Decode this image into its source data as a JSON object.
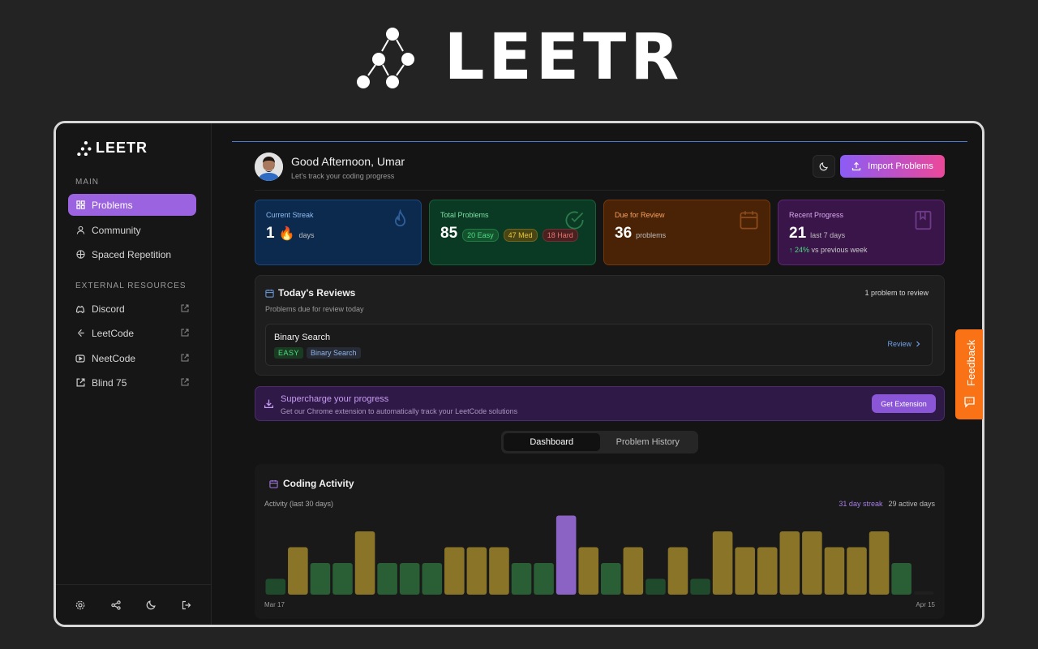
{
  "hero": {
    "title": "LEETR"
  },
  "sidebar": {
    "brand": "LEETR",
    "main_heading": "MAIN",
    "main_items": [
      {
        "label": "Problems",
        "icon": "grid-icon",
        "active": true
      },
      {
        "label": "Community",
        "icon": "user-icon",
        "active": false
      },
      {
        "label": "Spaced Repetition",
        "icon": "brain-icon",
        "active": false
      }
    ],
    "external_heading": "EXTERNAL RESOURCES",
    "external_items": [
      {
        "label": "Discord",
        "icon": "discord-icon"
      },
      {
        "label": "LeetCode",
        "icon": "leetcode-icon"
      },
      {
        "label": "NeetCode",
        "icon": "youtube-icon"
      },
      {
        "label": "Blind 75",
        "icon": "external-link-icon"
      }
    ],
    "bottom_icons": [
      "settings-icon",
      "share-icon",
      "moon-icon",
      "logout-icon"
    ]
  },
  "header": {
    "greeting": "Good Afternoon, Umar",
    "subtitle": "Let's track your coding progress",
    "import_label": "Import Problems"
  },
  "stats": {
    "streak": {
      "label": "Current Streak",
      "value": "1",
      "emoji": "🔥",
      "unit": "days"
    },
    "total": {
      "label": "Total Problems",
      "value": "85",
      "easy": "20 Easy",
      "med": "47 Med",
      "hard": "18 Hard"
    },
    "due": {
      "label": "Due for Review",
      "value": "36",
      "unit": "problems"
    },
    "recent": {
      "label": "Recent Progress",
      "value": "21",
      "unit": "last 7 days",
      "trend_pct": "↑ 24%",
      "trend_text": "vs previous week"
    }
  },
  "reviews": {
    "title": "Today's Reviews",
    "count": "1 problem to review",
    "subtitle": "Problems due for review today",
    "item": {
      "name": "Binary Search",
      "difficulty": "EASY",
      "topic": "Binary Search",
      "action": "Review"
    }
  },
  "promo": {
    "title": "Supercharge your progress",
    "subtitle": "Get our Chrome extension to automatically track your LeetCode solutions",
    "button": "Get Extension"
  },
  "tabs": [
    "Dashboard",
    "Problem History"
  ],
  "activity": {
    "title": "Coding Activity",
    "subtitle": "Activity (last 30 days)",
    "streak": "31 day streak",
    "active_days": "29 active days",
    "x_start": "Mar 17",
    "x_end": "Apr 15"
  },
  "chart_data": {
    "type": "bar",
    "values": [
      1,
      3,
      2,
      2,
      4,
      2,
      2,
      2,
      3,
      3,
      3,
      2,
      2,
      5,
      3,
      2,
      3,
      1,
      3,
      1,
      4,
      3,
      3,
      4,
      4,
      3,
      3,
      4,
      2,
      0
    ],
    "highlight_index": 13,
    "colors": {
      "low": "#1f4a2b",
      "mid": "#2a5f35",
      "high": "#8a7428",
      "highlight": "#8a63c4",
      "empty": "#1f1f1f"
    },
    "xlabel_start": "Mar 17",
    "xlabel_end": "Apr 15"
  },
  "feedback": {
    "label": "Feedback"
  },
  "colors": {
    "accent": "#9b63e0",
    "streak_bg": "#0c2a4e",
    "total_bg": "#0a3a24",
    "due_bg": "#4a2306",
    "recent_bg": "#3a1549",
    "feedback": "#f97316"
  }
}
